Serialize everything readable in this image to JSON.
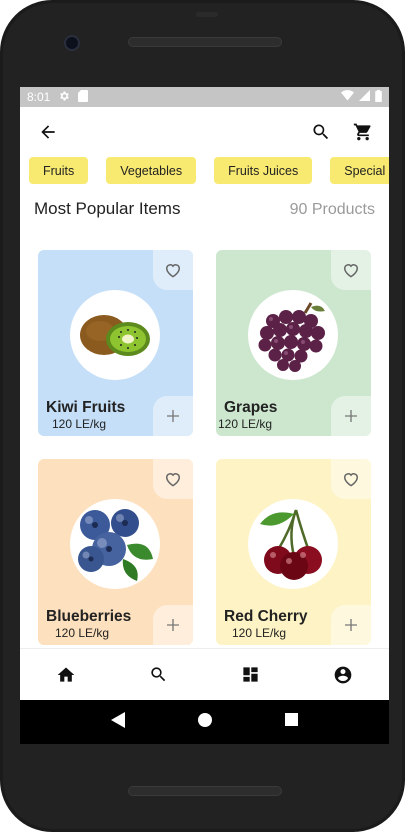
{
  "status_bar": {
    "time": "8:01"
  },
  "app_bar": {
    "back_icon": "arrow-back-icon",
    "search_icon": "search-icon",
    "cart_icon": "shopping-cart-icon"
  },
  "categories": [
    "Fruits",
    "Vegetables",
    "Fruits Juices",
    "Special I"
  ],
  "section": {
    "title": "Most Popular Items",
    "count": "90 Products"
  },
  "products": [
    {
      "name": "Kiwi Fruits",
      "price": "120 LE/kg",
      "bg": "#c5dff8",
      "icon": "kiwi-image"
    },
    {
      "name": "Grapes",
      "price": "120 LE/kg",
      "bg": "#cde7cf",
      "icon": "grapes-image"
    },
    {
      "name": "Blueberries",
      "price": "120 LE/kg",
      "bg": "#fde0bd",
      "icon": "blueberries-image"
    },
    {
      "name": "Red Cherry",
      "price": "120 LE/kg",
      "bg": "#fdf3c4",
      "icon": "cherry-image"
    }
  ],
  "bottom_nav": [
    "home-icon",
    "search-icon",
    "dashboard-icon",
    "account-icon"
  ],
  "colors": {
    "chip": "#f8ea70",
    "status_bar": "#c5c5c5",
    "accent_dark": "#111111"
  }
}
